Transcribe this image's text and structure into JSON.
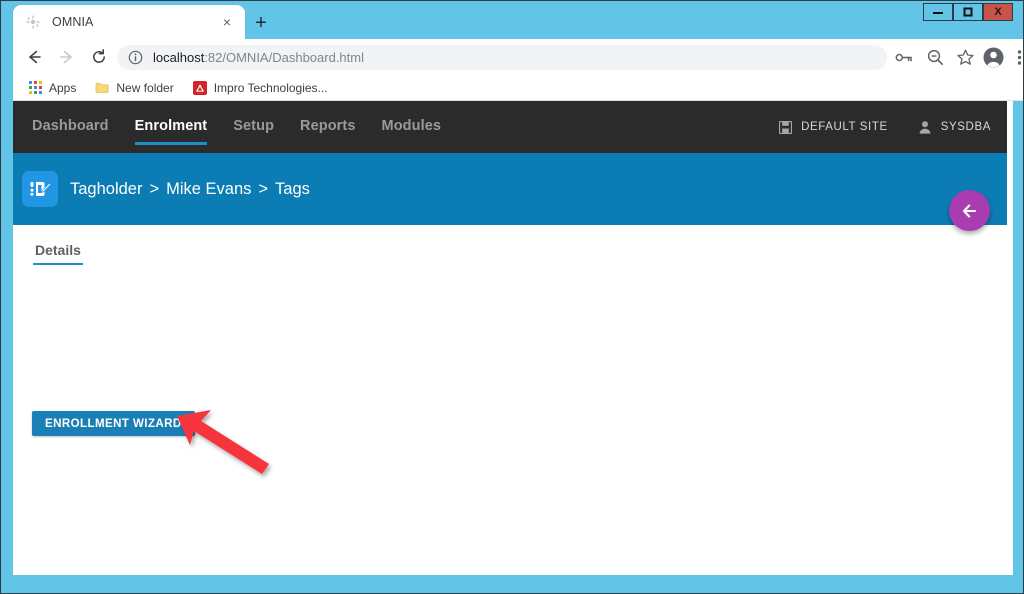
{
  "browser": {
    "tab": {
      "title": "OMNIA",
      "favicon": "omnia-favicon",
      "close_label": "×"
    },
    "new_tab_label": "+",
    "window_controls": {
      "minimize": "–",
      "maximize": "□",
      "close": "X"
    },
    "toolbar": {
      "back": "←",
      "forward": "→",
      "reload": "↻",
      "url_prefix": "localhost",
      "url_rest": ":82/OMNIA/Dashboard.html",
      "site_info_icon": "info-icon",
      "icons": [
        "key-icon",
        "zoom-out-icon",
        "star-icon",
        "profile-avatar-icon",
        "three-dot-menu-icon"
      ]
    },
    "bookmarks": [
      {
        "label": "Apps",
        "icon": "apps-grid-icon"
      },
      {
        "label": "New folder",
        "icon": "folder-icon"
      },
      {
        "label": "Impro Technologies...",
        "icon": "impro-icon"
      }
    ]
  },
  "app": {
    "nav_items": [
      {
        "label": "Dashboard",
        "active": false
      },
      {
        "label": "Enrolment",
        "active": true
      },
      {
        "label": "Setup",
        "active": false
      },
      {
        "label": "Reports",
        "active": false
      },
      {
        "label": "Modules",
        "active": false
      }
    ],
    "site_chip": {
      "label": "DEFAULT SITE",
      "icon": "save-disk-icon"
    },
    "user_chip": {
      "label": "SYSDBA",
      "icon": "user-icon"
    },
    "breadcrumb": {
      "icon": "tagholder-tag-icon",
      "items": [
        "Tagholder",
        "Mike Evans",
        "Tags"
      ],
      "separator": ">"
    },
    "back_fab": {
      "icon": "arrow-left-icon"
    },
    "tabs": [
      {
        "label": "Details",
        "active": true
      }
    ],
    "primary_button": {
      "label": "ENROLLMENT WIZARD"
    },
    "annotation": {
      "type": "arrow",
      "color": "#f5343a",
      "points_to": "ENROLLMENT WIZARD"
    }
  },
  "colors": {
    "window_frame": "#62c5e8",
    "app_nav": "#2b2b2b",
    "header_blue": "#0c7cb4",
    "accent_blue": "#1f8fc6",
    "button_blue": "#1a7fb5",
    "fab_purple": "#a83cb0",
    "arrow_red": "#f5343a"
  }
}
